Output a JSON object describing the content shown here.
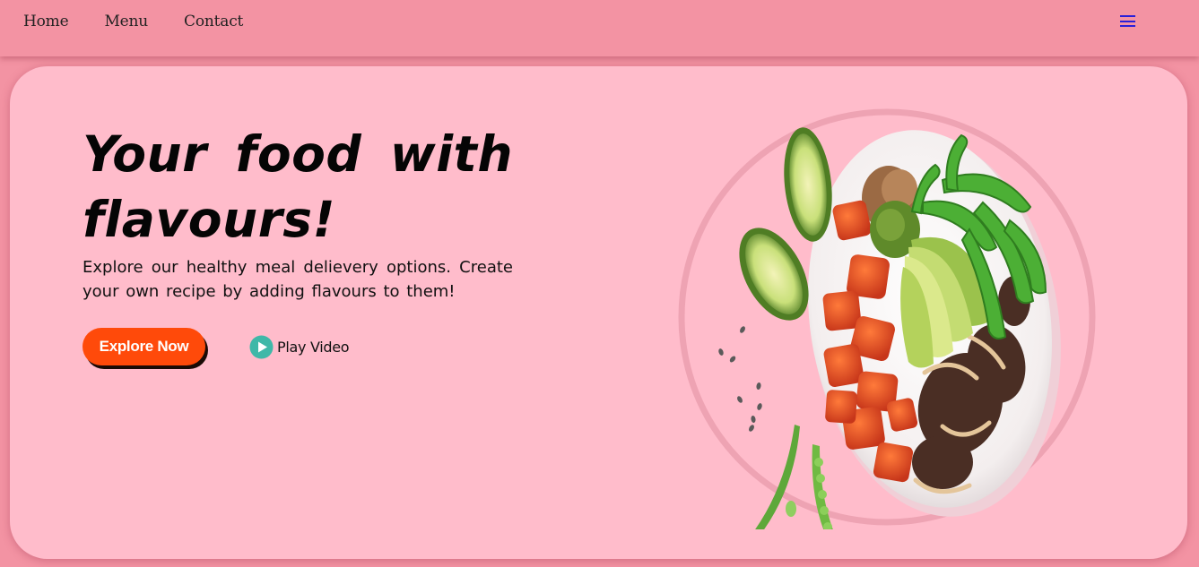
{
  "nav": {
    "links": [
      {
        "label": "Home"
      },
      {
        "label": "Menu"
      },
      {
        "label": "Contact"
      }
    ],
    "menu_icon": "hamburger-icon"
  },
  "hero": {
    "headline": "Your food with flavours!",
    "description": "Explore our healthy meal delievery options. Create your own recipe by adding flavours to them!",
    "explore_label": "Explore Now",
    "play_label": "Play Video",
    "play_icon": "play-circle-icon",
    "image": "salad-bowl"
  },
  "colors": {
    "page_bg": "#f393a3",
    "card_bg": "#ffbccb",
    "accent": "#ff4a0a",
    "play_icon": "#3fb8a8",
    "menu_icon": "#2b1fd8"
  }
}
